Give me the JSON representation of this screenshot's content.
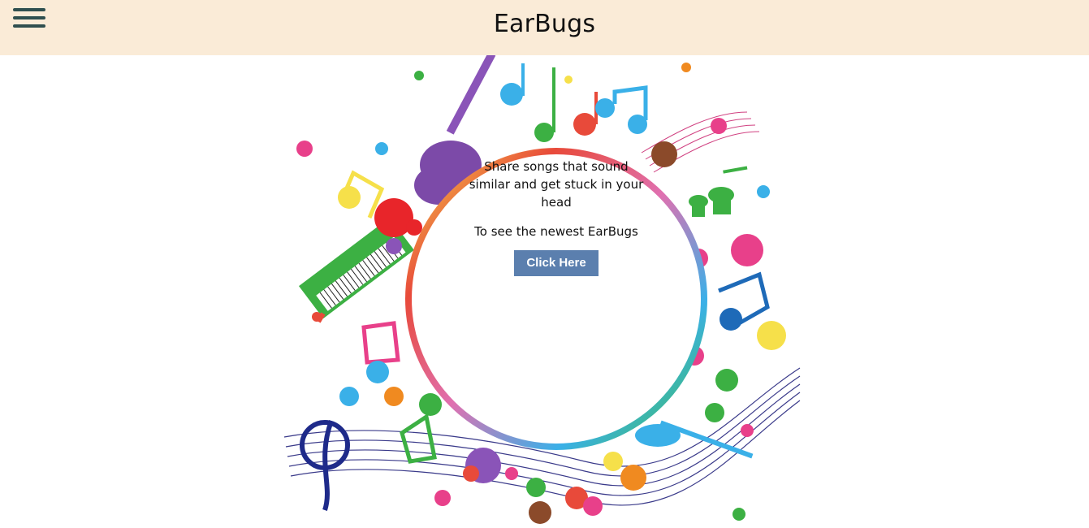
{
  "header": {
    "title": "EarBugs",
    "menu_icon": "hamburger-menu-icon",
    "background": "#faebd7"
  },
  "main": {
    "tagline": "Share songs that sound similar and get stuck in your head",
    "prompt": "To see the newest EarBugs",
    "cta_label": "Click Here",
    "cta_color": "#5b7fae",
    "illustration": "music-notes-ring-illustration"
  }
}
